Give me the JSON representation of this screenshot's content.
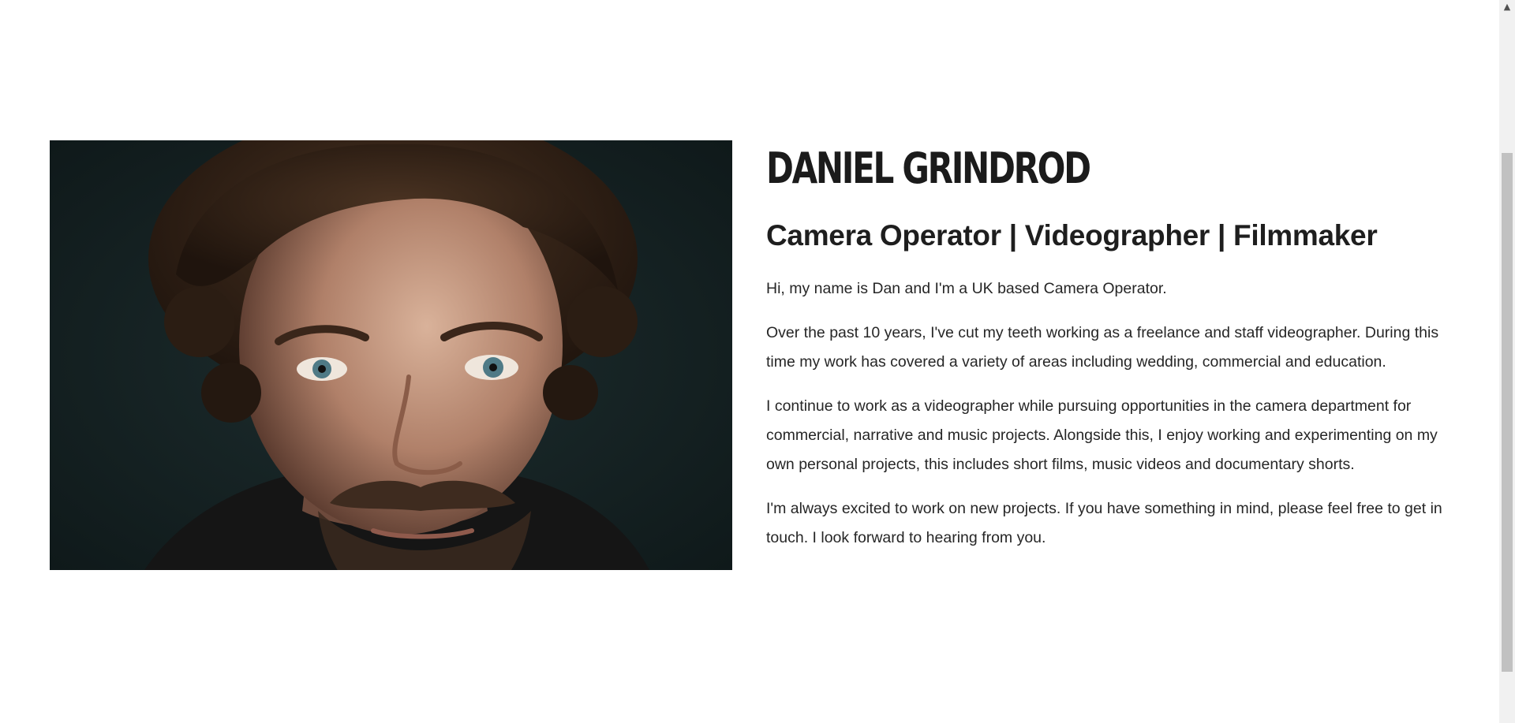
{
  "profile": {
    "name": "Daniel Grindrod",
    "subtitle": "Camera Operator | Videographer | Filmmaker",
    "paragraphs": [
      "Hi, my name is Dan and I'm a UK based Camera Operator.",
      "Over the past 10 years, I've cut my teeth working as a freelance and staff videographer. During this time my work has covered a variety of areas including wedding, commercial and education.",
      "I continue to work as a videographer while pursuing opportunities in the camera department for commercial, narrative and music projects. Alongside this, I enjoy working and experimenting on my own personal projects, this includes short films, music videos and documentary shorts.",
      "I'm always excited to work on new projects. If you have something in mind, please feel free to get in touch. I look forward to hearing from you."
    ]
  },
  "scrollbar": {
    "up_arrow_icon": "chevron-up-icon"
  }
}
